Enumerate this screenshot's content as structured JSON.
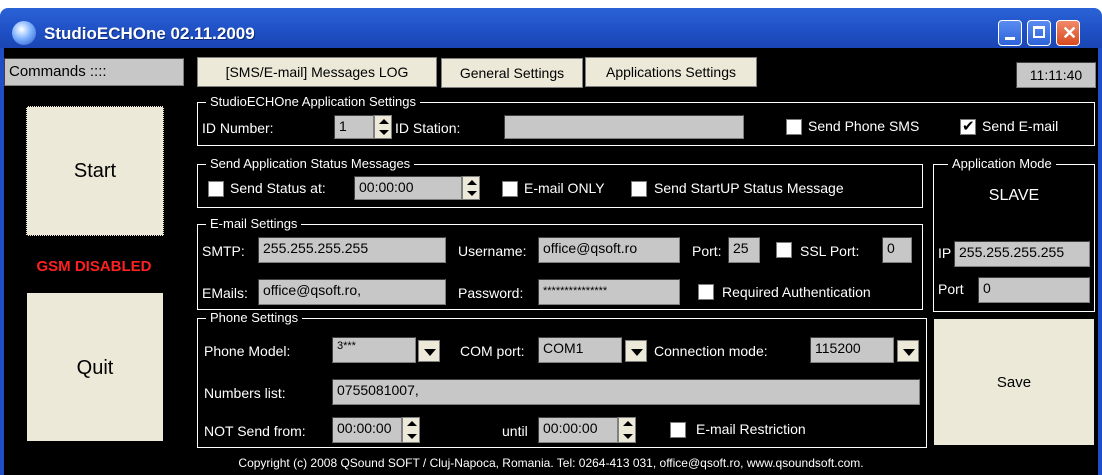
{
  "window": {
    "title": "StudioECHOne 02.11.2009"
  },
  "sidebar": {
    "commands_label": "Commands ::::",
    "start_label": "Start",
    "gsm_status": "GSM DISABLED",
    "quit_label": "Quit"
  },
  "tabs": [
    {
      "label": "[SMS/E-mail] Messages LOG"
    },
    {
      "label": "General Settings"
    },
    {
      "label": "Applications Settings"
    }
  ],
  "clock": "11:11:40",
  "app_settings": {
    "legend": "StudioECHOne Application Settings",
    "id_number_label": "ID Number:",
    "id_number_value": "1",
    "id_station_label": "ID Station:",
    "id_station_value": "",
    "send_phone_sms_label": "Send Phone SMS",
    "send_phone_sms_checked": false,
    "send_email_label": "Send E-mail",
    "send_email_checked": true
  },
  "status_messages": {
    "legend": "Send Application Status Messages",
    "send_status_label": "Send Status at:",
    "send_status_checked": false,
    "time_value": "00:00:00",
    "email_only_label": "E-mail ONLY",
    "email_only_checked": false,
    "startup_label": "Send StartUP Status Message",
    "startup_checked": false
  },
  "app_mode": {
    "legend": "Application Mode",
    "mode": "SLAVE",
    "ip_label": "IP",
    "ip_value": "255.255.255.255",
    "port_label": "Port",
    "port_value": "0"
  },
  "email_settings": {
    "legend": "E-mail Settings",
    "smtp_label": "SMTP:",
    "smtp_value": "255.255.255.255",
    "username_label": "Username:",
    "username_value": "office@qsoft.ro",
    "port_label": "Port:",
    "port_value": "25",
    "ssl_label": "SSL Port:",
    "ssl_checked": false,
    "ssl_value": "0",
    "emails_label": "EMails:",
    "emails_value": "office@qsoft.ro,",
    "password_label": "Password:",
    "password_value": "***************",
    "required_auth_label": "Required Authentication",
    "required_auth_checked": false
  },
  "phone_settings": {
    "legend": "Phone Settings",
    "phone_model_label": "Phone Model:",
    "phone_model_value": "3***",
    "com_port_label": "COM port:",
    "com_port_value": "COM1",
    "connection_mode_label": "Connection mode:",
    "connection_mode_value": "115200",
    "numbers_list_label": "Numbers list:",
    "numbers_list_value": "0755081007,",
    "not_send_from_label": "NOT Send from:",
    "not_send_from_value": "00:00:00",
    "until_label": "until",
    "until_value": "00:00:00",
    "email_restriction_label": "E-mail Restriction",
    "email_restriction_checked": false
  },
  "save_label": "Save",
  "footer": "Copyright (c) 2008  QSound SOFT / Cluj-Napoca, Romania. Tel: 0264-413 031, office@qsoft.ro, www.qsoundsoft.com."
}
